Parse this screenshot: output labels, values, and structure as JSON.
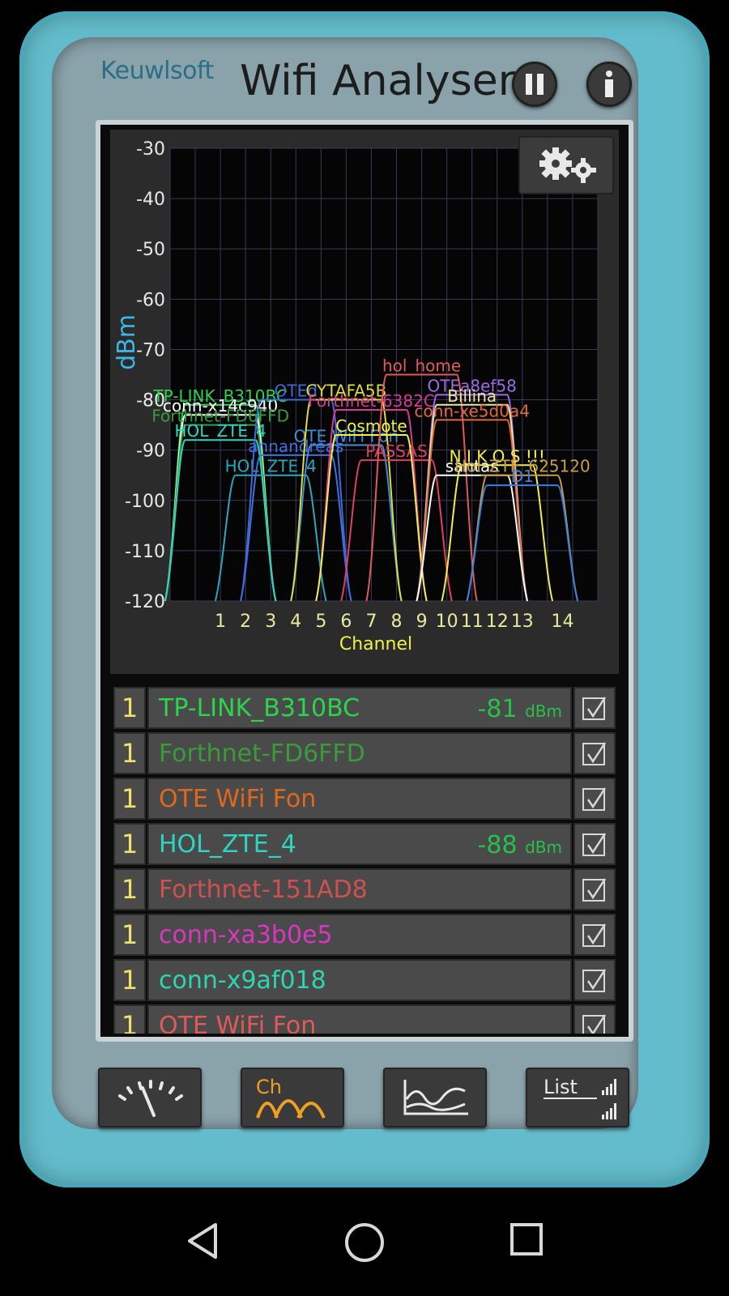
{
  "header": {
    "brand": "Keuwlsoft",
    "title": "Wifi Analyser"
  },
  "chart_data": {
    "type": "line",
    "ylabel": "dBm",
    "xlabel": "Channel",
    "ylim": [
      -120,
      -30
    ],
    "xlim": [
      -1,
      16
    ],
    "y_ticks": [
      "-30",
      "-40",
      "-50",
      "-60",
      "-70",
      "-80",
      "-90",
      "-100",
      "-110",
      "-120"
    ],
    "x_ticks": [
      "1",
      "2",
      "3",
      "4",
      "5",
      "6",
      "7",
      "8",
      "9",
      "10",
      "11",
      "12",
      "13",
      "14"
    ],
    "grid": true,
    "series": [
      {
        "name": "TP-LINK_B310BC",
        "channel": 1,
        "level": -81,
        "color": "#2bd44d"
      },
      {
        "name": "conn-x14c940",
        "channel": 1,
        "level": -83,
        "color": "#ffffff"
      },
      {
        "name": "Forthnet-FD6FFD",
        "channel": 1,
        "level": -85,
        "color": "#3b9a3b"
      },
      {
        "name": "HOL_ZTE_4",
        "channel": 1,
        "level": -88,
        "color": "#2fd5c0"
      },
      {
        "name": "HOL_ZTE_4",
        "channel": 3,
        "level": -95,
        "color": "#2aa8b8"
      },
      {
        "name": "annandreas",
        "channel": 4,
        "level": -91,
        "color": "#3f6fe0"
      },
      {
        "name": "OTE WiFi Fon",
        "channel": 6,
        "level": -89,
        "color": "#3f8fd8"
      },
      {
        "name": "OTEd",
        "channel": 4,
        "level": -80,
        "color": "#3d6ad8"
      },
      {
        "name": "CYTAFA5B",
        "channel": 6,
        "level": -80,
        "color": "#dcdc3a"
      },
      {
        "name": "Forthnet-6382C",
        "channel": 7,
        "level": -82,
        "color": "#d8389a"
      },
      {
        "name": "PASSAS",
        "channel": 8,
        "level": -92,
        "color": "#e04060"
      },
      {
        "name": "Cosmote",
        "channel": 7,
        "level": -87,
        "color": "#f0f04a"
      },
      {
        "name": "hol_home",
        "channel": 9,
        "level": -75,
        "color": "#e05a5a"
      },
      {
        "name": "OTEa8ef58",
        "channel": 11,
        "level": -79,
        "color": "#9e6ae6"
      },
      {
        "name": "Billina",
        "channel": 11,
        "level": -81,
        "color": "#e8e8a0"
      },
      {
        "name": "conn-xe5d0a4",
        "channel": 11,
        "level": -84,
        "color": "#e06a3a"
      },
      {
        "name": "santas",
        "channel": 11,
        "level": -95,
        "color": "#ffffff"
      },
      {
        "name": "N I K O S !!!",
        "channel": 12,
        "level": -93,
        "color": "#f0f04a"
      },
      {
        "name": "Hol_ZTE_625120",
        "channel": 13,
        "level": -95,
        "color": "#c8a040"
      },
      {
        "name": "D1",
        "channel": 13,
        "level": -97,
        "color": "#3c7fe0"
      }
    ]
  },
  "networks": [
    {
      "channel": "1",
      "ssid": "TP-LINK_B310BC",
      "level": "-81",
      "unit": "dBm",
      "color": "#2bd44d"
    },
    {
      "channel": "1",
      "ssid": "Forthnet-FD6FFD",
      "level": "",
      "unit": "",
      "color": "#3b9a3b"
    },
    {
      "channel": "1",
      "ssid": "OTE WiFi Fon",
      "level": "",
      "unit": "",
      "color": "#e0681e"
    },
    {
      "channel": "1",
      "ssid": "HOL_ZTE_4",
      "level": "-88",
      "unit": "dBm",
      "color": "#2fd5c0"
    },
    {
      "channel": "1",
      "ssid": "Forthnet-151AD8",
      "level": "",
      "unit": "",
      "color": "#d05050"
    },
    {
      "channel": "1",
      "ssid": "conn-xa3b0e5",
      "level": "",
      "unit": "",
      "color": "#d838c0"
    },
    {
      "channel": "1",
      "ssid": "conn-x9af018",
      "level": "",
      "unit": "",
      "color": "#2fd5b0"
    },
    {
      "channel": "1",
      "ssid": "OTE WiFi Fon",
      "level": "",
      "unit": "",
      "color": "#e05a5a"
    }
  ],
  "colors": {
    "device": "#63bccb",
    "panel": "#2b2b2b",
    "axis_label": "#3ab9e8",
    "tick_label": "#e8e8a0",
    "accent": "#f0a020"
  },
  "icons": {
    "pause": "pause-icon",
    "info": "info-icon",
    "settings": "gears-icon",
    "meter": "signal-meter-icon",
    "channel": "channel-graph-icon",
    "time": "time-graph-icon",
    "list": "list-icon",
    "back": "back-triangle-icon",
    "home": "home-circle-icon",
    "recents": "recents-square-icon"
  }
}
